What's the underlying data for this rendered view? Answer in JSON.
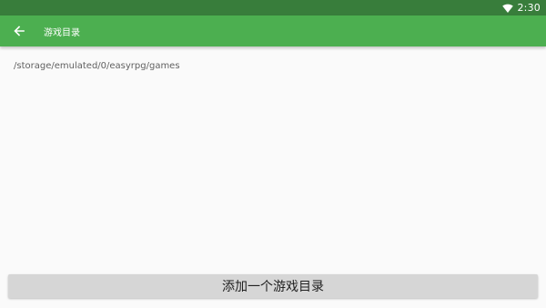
{
  "status_bar": {
    "time": "2:30",
    "icons": [
      "wifi-icon"
    ],
    "color": "#387d3b"
  },
  "app_bar": {
    "back_icon": "arrow-back-icon",
    "title": "游戏目录",
    "color": "#4caf50"
  },
  "directories": [
    {
      "path": "/storage/emulated/0/easyrpg/games"
    }
  ],
  "actions": {
    "add_directory_label": "添加一个游戏目录"
  }
}
